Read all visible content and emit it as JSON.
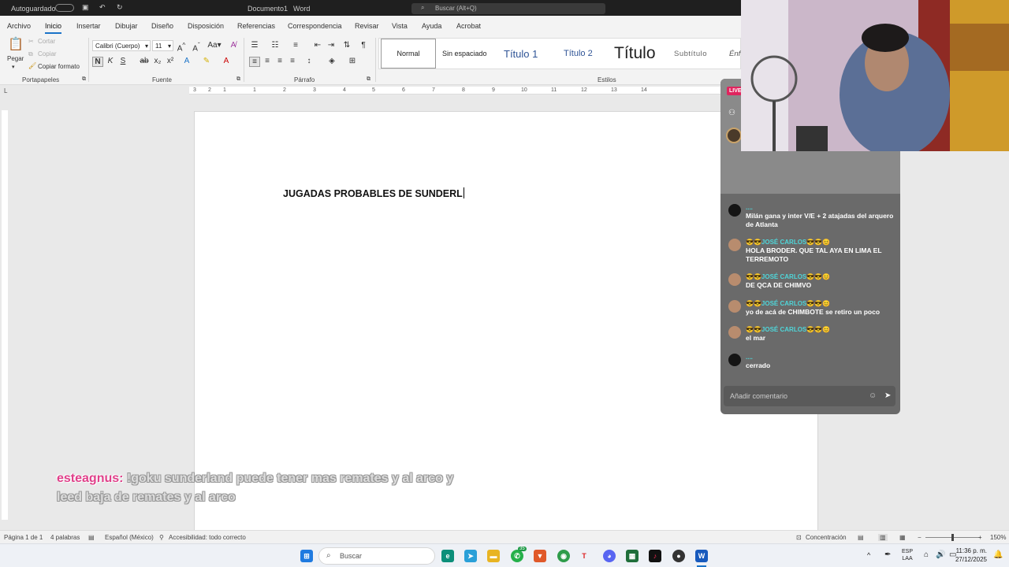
{
  "titlebar": {
    "autosave": "Autoguardado",
    "doc_title": "Documento1",
    "app": "Word",
    "search_placeholder": "Buscar (Alt+Q)"
  },
  "menu": [
    "Archivo",
    "Inicio",
    "Insertar",
    "Dibujar",
    "Diseño",
    "Disposición",
    "Referencias",
    "Correspondencia",
    "Revisar",
    "Vista",
    "Ayuda",
    "Acrobat"
  ],
  "ribbon": {
    "clipboard": {
      "paste": "Pegar",
      "cut": "Cortar",
      "copy": "Copiar",
      "format_painter": "Copiar formato",
      "group": "Portapapeles"
    },
    "font": {
      "name": "Calibri (Cuerpo)",
      "size": "11",
      "group": "Fuente",
      "bold": "N",
      "italic": "K",
      "underline": "S"
    },
    "paragraph": {
      "group": "Párrafo"
    },
    "styles": {
      "group": "Estilos",
      "items": [
        "Normal",
        "Sin espaciado",
        "Título 1",
        "Título 2",
        "Título",
        "Subtítulo",
        "Énf"
      ]
    }
  },
  "ruler": {
    "numbers": [
      "3",
      "2",
      "1",
      "1",
      "2",
      "3",
      "4",
      "5",
      "6",
      "7",
      "8",
      "9",
      "10",
      "11",
      "12",
      "13",
      "14"
    ]
  },
  "document": {
    "text": "JUGADAS PROBABLES DE SUNDERL"
  },
  "overlay": {
    "user": "esteagnus:",
    "message": "!goku sunderland puede tener mas remates y al arco y leed baja de remates y al arco"
  },
  "chat": {
    "live_label": "LIVE",
    "messages": [
      {
        "name": "....",
        "text": "Milán gana y inter V/E + 2 atajadas del arquero de Atlanta",
        "avatar": "dark"
      },
      {
        "name": "😎😎JOSÉ CARLOS😎😎😊",
        "text": "HOLA BRODER. QUE TAL AYA EN LIMA EL TERREMOTO",
        "avatar": "photo"
      },
      {
        "name": "😎😎JOSÉ CARLOS😎😎😊",
        "text": "DE QCA DE CHIMVO",
        "avatar": "photo"
      },
      {
        "name": "😎😎JOSÉ CARLOS😎😎😊",
        "text": "yo de acá de CHIMBOTE se retiro un poco",
        "avatar": "photo"
      },
      {
        "name": "😎😎JOSÉ CARLOS😎😎😊",
        "text": "el mar",
        "avatar": "photo"
      },
      {
        "name": "....",
        "text": "cerrado",
        "avatar": "dark"
      }
    ],
    "input_placeholder": "Añadir comentario"
  },
  "status": {
    "page": "Página 1 de 1",
    "words": "4 palabras",
    "language": "Español (México)",
    "accessibility": "Accesibilidad: todo correcto",
    "focus": "Concentración",
    "zoom": "150%"
  },
  "taskbar": {
    "search": "Buscar",
    "badge": "35",
    "lang": "ESP",
    "lang2": "LAA",
    "time": "11:36 p. m.",
    "date": "27/12/2025"
  },
  "colors": {
    "accent": "#1a73c8",
    "chat_name": "#4fd5d8",
    "overlay_user": "#e0408a"
  }
}
